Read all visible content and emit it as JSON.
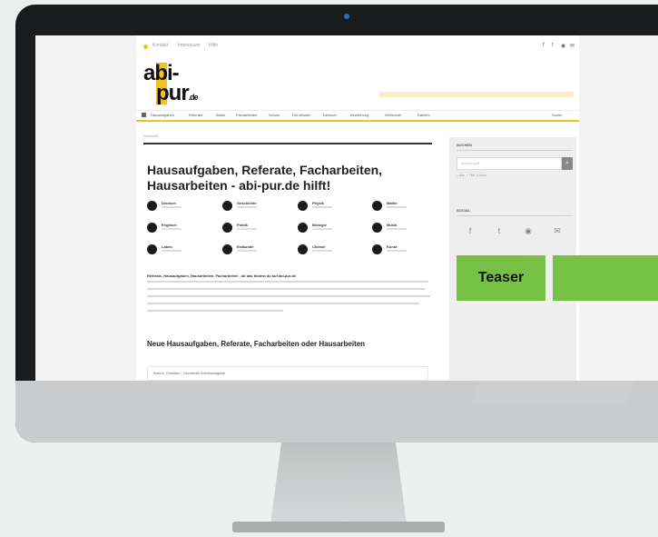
{
  "site": {
    "topbar_links": [
      "Kontakt",
      "Impressum",
      "Hilfe"
    ],
    "logo": {
      "line1": "abi-",
      "line2": "pur",
      "tld": ".de"
    },
    "nav_items": [
      "Hausaufgaben",
      "Referate",
      "Abitur",
      "Facharbeiten",
      "Schule",
      "Uni-Wissen",
      "Deutsch",
      "Bewerbung",
      "Wirtschaft",
      "Dateien"
    ],
    "search_label": "Suche",
    "breadcrumb": "Startseite",
    "headline": "Hausaufgaben, Referate, Facharbeiten, Hausarbeiten - abi-pur.de hilft!",
    "categories": [
      {
        "label": "Deutsch"
      },
      {
        "label": "Geschichte"
      },
      {
        "label": "Physik"
      },
      {
        "label": "Mathe"
      },
      {
        "label": "Englisch"
      },
      {
        "label": "Politik"
      },
      {
        "label": "Biologie"
      },
      {
        "label": "Musik"
      },
      {
        "label": "Latein"
      },
      {
        "label": "Erdkunde"
      },
      {
        "label": "Chemie"
      },
      {
        "label": "Kunst"
      }
    ],
    "intro_title": "Referate, Hausaufgaben, Hausarbeiten, Facharbeiten - all das findest du auf abi-pur.de",
    "section_title": "Neue Hausaufgaben, Referate, Facharbeiten oder Hausarbeiten",
    "first_item": "Brecht, Christian - Dreiviertel Arbeitsaufgabe"
  },
  "sidebar": {
    "search_title": "SUCHEN",
    "search_placeholder": "Suchbegriff",
    "search_button_icon": "search-icon",
    "radio_options": [
      "Alle",
      "Titel",
      "Autor"
    ],
    "social_title": "SOCIAL",
    "social_icons": [
      "facebook-icon",
      "twitter-icon",
      "rss-icon",
      "mail-icon"
    ]
  },
  "overlay": {
    "teaser_label": "Teaser"
  },
  "colors": {
    "accent": "#f4c21a",
    "teaser": "#76c043",
    "bezel": "#1a1b1d"
  }
}
